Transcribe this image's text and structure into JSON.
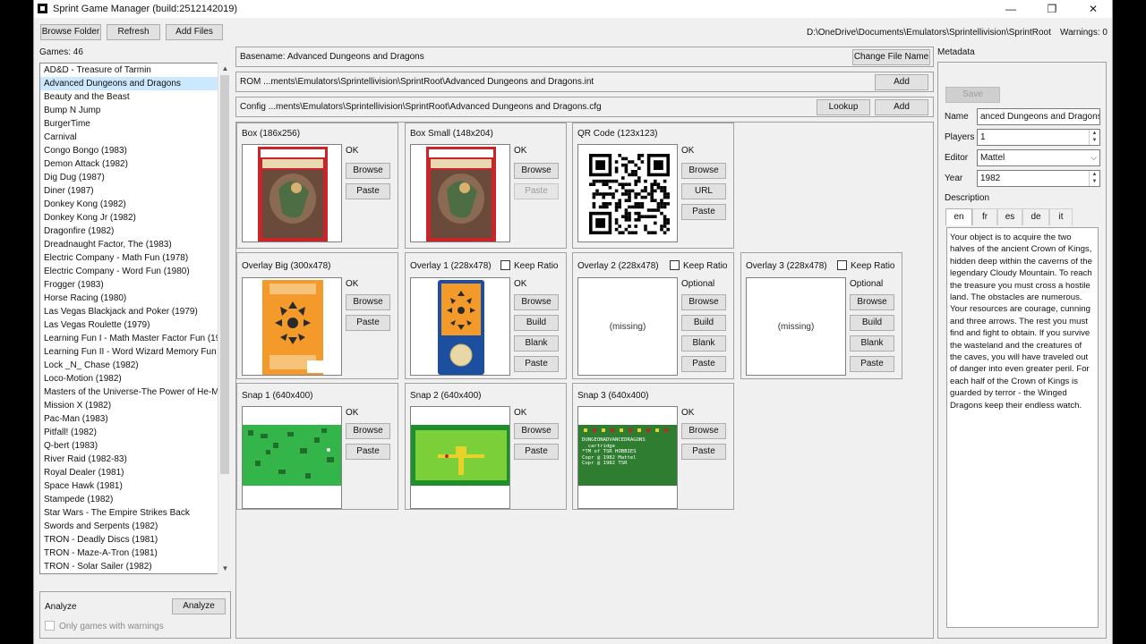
{
  "window": {
    "title": "Sprint Game Manager (build:2512142019)",
    "controls": {
      "minimize": "—",
      "maximize": "❐",
      "close": "✕"
    }
  },
  "toolbar": {
    "browse_folder": "Browse Folder",
    "refresh": "Refresh",
    "add_files": "Add Files",
    "root_path": "D:\\OneDrive\\Documents\\Emulators\\Sprintellivision\\SprintRoot",
    "warnings": "Warnings: 0"
  },
  "games": {
    "count_label": "Games: 46",
    "items": [
      "AD&D - Treasure of Tarmin",
      "Advanced Dungeons and Dragons",
      "Beauty and the Beast",
      "Bump N Jump",
      "BurgerTime",
      "Carnival",
      "Congo Bongo (1983)",
      "Demon Attack (1982)",
      "Dig Dug (1987)",
      "Diner (1987)",
      "Donkey Kong (1982)",
      "Donkey Kong Jr (1982)",
      "Dragonfire (1982)",
      "Dreadnaught Factor, The (1983)",
      "Electric Company - Math Fun (1978)",
      "Electric Company - Word Fun (1980)",
      "Frogger (1983)",
      "Horse Racing (1980)",
      "Las Vegas Blackjack and Poker (1979)",
      "Las Vegas Roulette (1979)",
      "Learning Fun I - Math Master Factor Fun (19",
      "Learning Fun II - Word Wizard Memory Fun",
      "Lock _N_ Chase (1982)",
      "Loco-Motion (1982)",
      "Masters of the Universe-The Power of He-M",
      "Mission X (1982)",
      "Pac-Man (1983)",
      "Pitfall! (1982)",
      "Q-bert (1983)",
      "River Raid (1982-83)",
      "Royal Dealer (1981)",
      "Space Hawk (1981)",
      "Stampede (1982)",
      "Star Wars - The Empire Strikes Back",
      "Swords and Serpents (1982)",
      "TRON - Deadly Discs (1981)",
      "TRON - Maze-A-Tron (1981)",
      "TRON - Solar Sailer (1982)"
    ],
    "selected_index": 1
  },
  "analyze": {
    "label": "Analyze",
    "button": "Analyze",
    "only_warnings": "Only games with warnings"
  },
  "detail": {
    "basename": "Basename: Advanced Dungeons and Dragons",
    "change_file_name": "Change File Name",
    "rom": "ROM ...ments\\Emulators\\Sprintellivision\\SprintRoot\\Advanced Dungeons and Dragons.int",
    "rom_add": "Add",
    "config": "Config ...ments\\Emulators\\Sprintellivision\\SprintRoot\\Advanced Dungeons and Dragons.cfg",
    "config_lookup": "Lookup",
    "config_add": "Add"
  },
  "cards": {
    "box": {
      "title": "Box (186x256)",
      "status": "OK",
      "browse": "Browse",
      "paste": "Paste"
    },
    "box_small": {
      "title": "Box Small (148x204)",
      "status": "OK",
      "browse": "Browse",
      "paste": "Paste"
    },
    "qr": {
      "title": "QR Code (123x123)",
      "status": "OK",
      "browse": "Browse",
      "url": "URL",
      "paste": "Paste"
    },
    "overlay_big": {
      "title": "Overlay Big (300x478)",
      "status": "OK",
      "browse": "Browse",
      "paste": "Paste"
    },
    "overlay1": {
      "title": "Overlay 1 (228x478)",
      "keep_ratio": "Keep Ratio",
      "status": "OK",
      "browse": "Browse",
      "build": "Build",
      "blank": "Blank",
      "paste": "Paste"
    },
    "overlay2": {
      "title": "Overlay 2 (228x478)",
      "keep_ratio": "Keep Ratio",
      "status": "Optional",
      "missing": "(missing)",
      "browse": "Browse",
      "build": "Build",
      "blank": "Blank",
      "paste": "Paste"
    },
    "overlay3": {
      "title": "Overlay 3 (228x478)",
      "keep_ratio": "Keep Ratio",
      "status": "Optional",
      "missing": "(missing)",
      "browse": "Browse",
      "build": "Build",
      "blank": "Blank",
      "paste": "Paste"
    },
    "snap1": {
      "title": "Snap 1 (640x400)",
      "status": "OK",
      "browse": "Browse",
      "paste": "Paste"
    },
    "snap2": {
      "title": "Snap 2 (640x400)",
      "status": "OK",
      "browse": "Browse",
      "paste": "Paste"
    },
    "snap3": {
      "title": "Snap 3 (640x400)",
      "status": "OK",
      "browse": "Browse",
      "paste": "Paste",
      "screen_text": "DUNGEONADVANCEDRAGONS\n  cartridge\n*TM of TSR HOBBIES\nCopr @ 1982 Mattel\nCopr @ 1982 TSR"
    }
  },
  "metadata": {
    "header": "Metadata",
    "save": "Save",
    "name_label": "Name",
    "name_value": "anced Dungeons and Dragons",
    "players_label": "Players",
    "players_value": "1",
    "editor_label": "Editor",
    "editor_value": "Mattel",
    "year_label": "Year",
    "year_value": "1982",
    "description_label": "Description",
    "tabs": [
      "en",
      "fr",
      "es",
      "de",
      "it"
    ],
    "active_tab": "en",
    "description": "Your object is to acquire the two halves of the ancient Crown of Kings, hidden deep within the caverns of the legendary Cloudy Mountain. To reach the treasure you must cross a hostile land. The obstacles are numerous. Your resources are courage, cunning and three arrows. The rest you must find and fight to obtain. If you survive the wasteland and the creatures of the caves, you will have traveled out of danger into even greater peril. For each half of the Crown of Kings is guarded by terror - the Winged Dragons keep their endless watch."
  },
  "colors": {
    "selection": "#cce8ff",
    "box_art_red": "#c8242a",
    "overlay_orange": "#f39a2b",
    "snap_green": "#33b54a",
    "snap_dark_green": "#1f6e2b"
  }
}
